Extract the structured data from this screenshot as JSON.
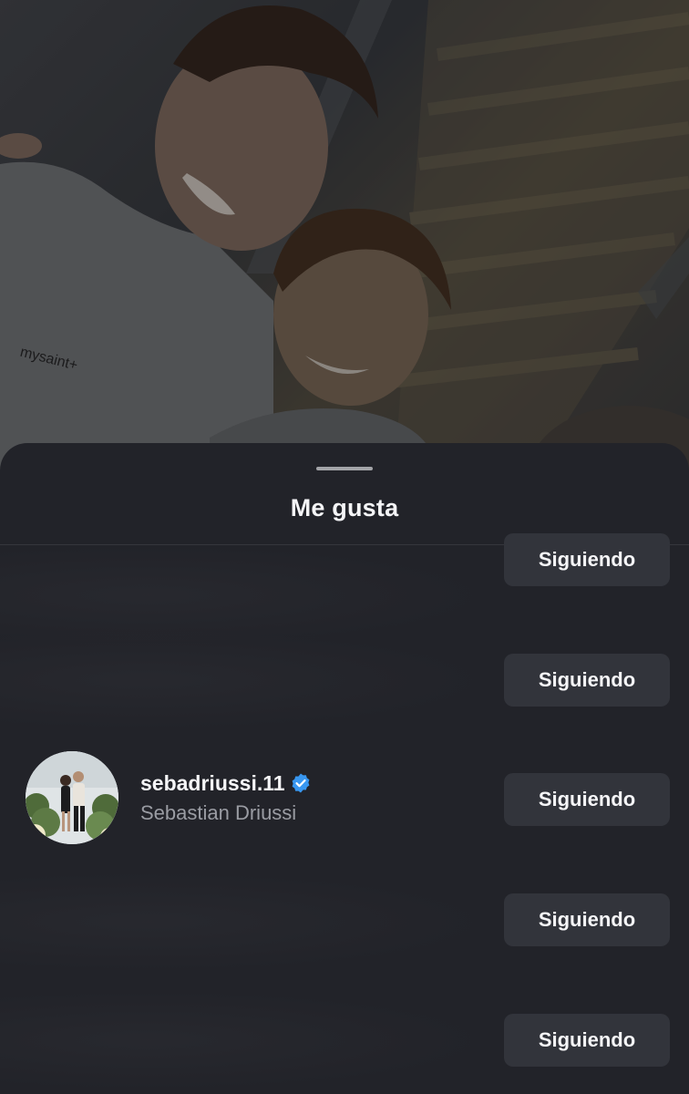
{
  "sheet": {
    "title": "Me gusta"
  },
  "photo": {
    "shirt_text": "mysaint+"
  },
  "likes_list": [
    {
      "username": "",
      "full_name": "",
      "follow_label": "Siguiendo",
      "hidden": true
    },
    {
      "username": "",
      "full_name": "",
      "follow_label": "Siguiendo",
      "hidden": true
    },
    {
      "username": "sebadriussi.11",
      "full_name": "Sebastian Driussi",
      "verified": true,
      "follow_label": "Siguiendo",
      "hidden": false
    },
    {
      "username": "",
      "full_name": "",
      "follow_label": "Siguiendo",
      "hidden": true
    },
    {
      "username": "",
      "full_name": "",
      "follow_label": "Siguiendo",
      "hidden": true
    }
  ],
  "colors": {
    "sheet_bg": "#222329",
    "button_bg": "#32343b",
    "verified_blue": "#3897f0",
    "secondary_text": "#9a9ca3"
  }
}
